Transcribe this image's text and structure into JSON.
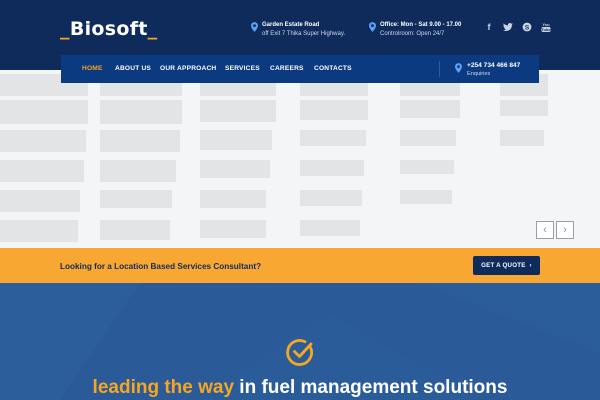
{
  "brand": {
    "logo_prefix": "_",
    "logo_name": "Biosoft",
    "logo_suffix": "_"
  },
  "header": {
    "address": {
      "line1": "Garden Estate Road",
      "line2": "off Exit 7 Thika Super Highway."
    },
    "office": {
      "line1": "Office: Mon - Sat 9.00 - 17.00",
      "line2": "Controlroom: Open 24/7"
    },
    "social": [
      "facebook-icon",
      "twitter-icon",
      "skype-icon",
      "youtube-icon"
    ]
  },
  "nav": {
    "items": [
      "HOME",
      "ABOUT US",
      "OUR APPROACH",
      "SERVICES",
      "CAREERS",
      "CONTACTS"
    ],
    "active": "HOME",
    "phone": {
      "number": "+254 734 466 847",
      "label": "Enquiries"
    }
  },
  "slider": {
    "prev": "‹",
    "next": "›"
  },
  "cta": {
    "question": "Looking for a Location Based Services Consultant?",
    "button": "GET A QUOTE",
    "button_arrow": "›"
  },
  "section": {
    "headline_highlight": "leading the way",
    "headline_rest": " in fuel management solutions"
  },
  "colors": {
    "navy": "#0e2b5c",
    "nav_blue": "#0c3a80",
    "accent": "#f5a623",
    "cta_bg": "#f8a832",
    "section_bg": "#2a5a98"
  }
}
